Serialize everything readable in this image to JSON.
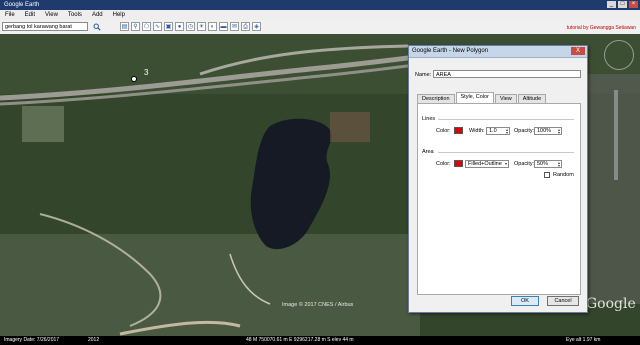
{
  "window": {
    "title": "Google Earth"
  },
  "menu": [
    "File",
    "Edit",
    "View",
    "Tools",
    "Add",
    "Help"
  ],
  "search": {
    "value": "gerbang tol karawang barat"
  },
  "toolbar": {
    "credit": "tutorial by Gewangga Setiawan"
  },
  "map": {
    "placemark_label": "3",
    "image_credit": "Image © 2017 CNES / Airbus",
    "logo": "Google"
  },
  "status": {
    "imagery_date": "Imagery Date: 7/26/2017",
    "year": "2012",
    "coords": "48 M 750070.61 m E 9296217.28 m S  elev   44 m",
    "eye_alt": "Eye alt    1.97 km"
  },
  "dialog": {
    "title": "Google Earth - New Polygon",
    "close_label": "X",
    "name_label": "Name:",
    "name_value": "AREA",
    "tabs": [
      "Description",
      "Style, Color",
      "View",
      "Altitude"
    ],
    "active_tab": "Style, Color",
    "lines": {
      "heading": "Lines",
      "color_label": "Color:",
      "width_label": "Width:",
      "width_value": "1.0",
      "opacity_label": "Opacity:",
      "opacity_value": "100%"
    },
    "area": {
      "heading": "Area",
      "color_label": "Color:",
      "fill_mode": "Filled+Outline",
      "opacity_label": "Opacity:",
      "opacity_value": "50%",
      "random_label": "Random"
    },
    "ok_label": "OK",
    "cancel_label": "Cancel"
  },
  "colors": {
    "line_color": "#e00000",
    "area_color": "#e00000",
    "lake": "#151a24",
    "vegetation": "#334a2a"
  }
}
